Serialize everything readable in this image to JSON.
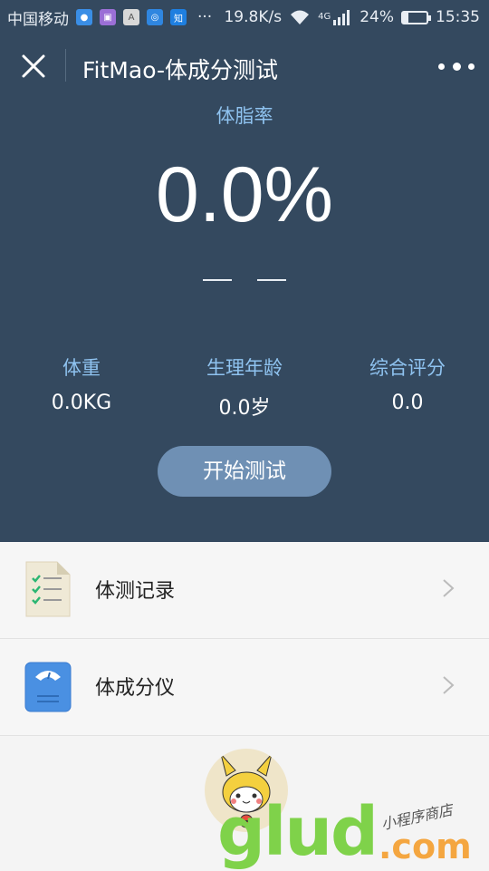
{
  "status_bar": {
    "carrier": "中国移动",
    "dots": "···",
    "speed": "19.8K/s",
    "network": "4G",
    "battery_percent": "24%",
    "battery_level": 0.24,
    "time": "15:35"
  },
  "header": {
    "title": "FitMao-体成分测试"
  },
  "hero": {
    "body_fat_label": "体脂率",
    "body_fat_value": "0.0%",
    "stats": [
      {
        "label": "体重",
        "value": "0.0KG"
      },
      {
        "label": "生理年龄",
        "value": "0.0岁"
      },
      {
        "label": "综合评分",
        "value": "0.0"
      }
    ],
    "start_button": "开始测试"
  },
  "menu": [
    {
      "label": "体测记录",
      "icon": "checklist-document-icon"
    },
    {
      "label": "体成分仪",
      "icon": "body-scale-icon"
    }
  ],
  "watermark": {
    "main": "glud",
    "com": ".com",
    "sub": "小程序商店"
  },
  "colors": {
    "header_bg": "#34495f",
    "accent_label": "#8fc3f0",
    "button_bg": "#6f90b4"
  }
}
